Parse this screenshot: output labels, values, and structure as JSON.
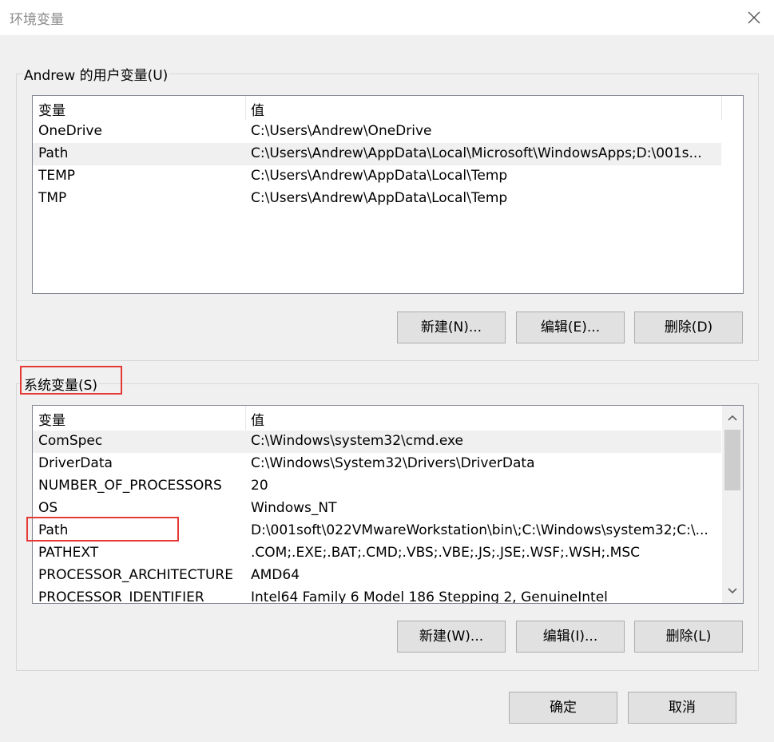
{
  "window": {
    "title": "环境变量",
    "close_icon": "close-icon"
  },
  "user_vars": {
    "group_label": "Andrew 的用户变量(U)",
    "columns": {
      "var": "变量",
      "val": "值"
    },
    "rows": [
      {
        "var": "OneDrive",
        "val": "C:\\Users\\Andrew\\OneDrive"
      },
      {
        "var": "Path",
        "val": "C:\\Users\\Andrew\\AppData\\Local\\Microsoft\\WindowsApps;D:\\001s..."
      },
      {
        "var": "TEMP",
        "val": "C:\\Users\\Andrew\\AppData\\Local\\Temp"
      },
      {
        "var": "TMP",
        "val": "C:\\Users\\Andrew\\AppData\\Local\\Temp"
      }
    ],
    "selected_row": 1,
    "buttons": {
      "new": "新建(N)...",
      "edit": "编辑(E)...",
      "delete": "删除(D)"
    }
  },
  "system_vars": {
    "group_label": "系统变量(S)",
    "columns": {
      "var": "变量",
      "val": "值"
    },
    "rows": [
      {
        "var": "ComSpec",
        "val": "C:\\Windows\\system32\\cmd.exe"
      },
      {
        "var": "DriverData",
        "val": "C:\\Windows\\System32\\Drivers\\DriverData"
      },
      {
        "var": "NUMBER_OF_PROCESSORS",
        "val": "20"
      },
      {
        "var": "OS",
        "val": "Windows_NT"
      },
      {
        "var": "Path",
        "val": "D:\\001soft\\022VMwareWorkstation\\bin\\;C:\\Windows\\system32;C:\\..."
      },
      {
        "var": "PATHEXT",
        "val": ".COM;.EXE;.BAT;.CMD;.VBS;.VBE;.JS;.JSE;.WSF;.WSH;.MSC"
      },
      {
        "var": "PROCESSOR_ARCHITECTURE",
        "val": "AMD64"
      },
      {
        "var": "PROCESSOR_IDENTIFIER",
        "val": "Intel64 Family 6 Model 186 Stepping 2, GenuineIntel"
      }
    ],
    "selected_row": 0,
    "buttons": {
      "new": "新建(W)...",
      "edit": "编辑(I)...",
      "delete": "删除(L)"
    }
  },
  "footer": {
    "ok": "确定",
    "cancel": "取消"
  },
  "highlight_color": "#e53935"
}
